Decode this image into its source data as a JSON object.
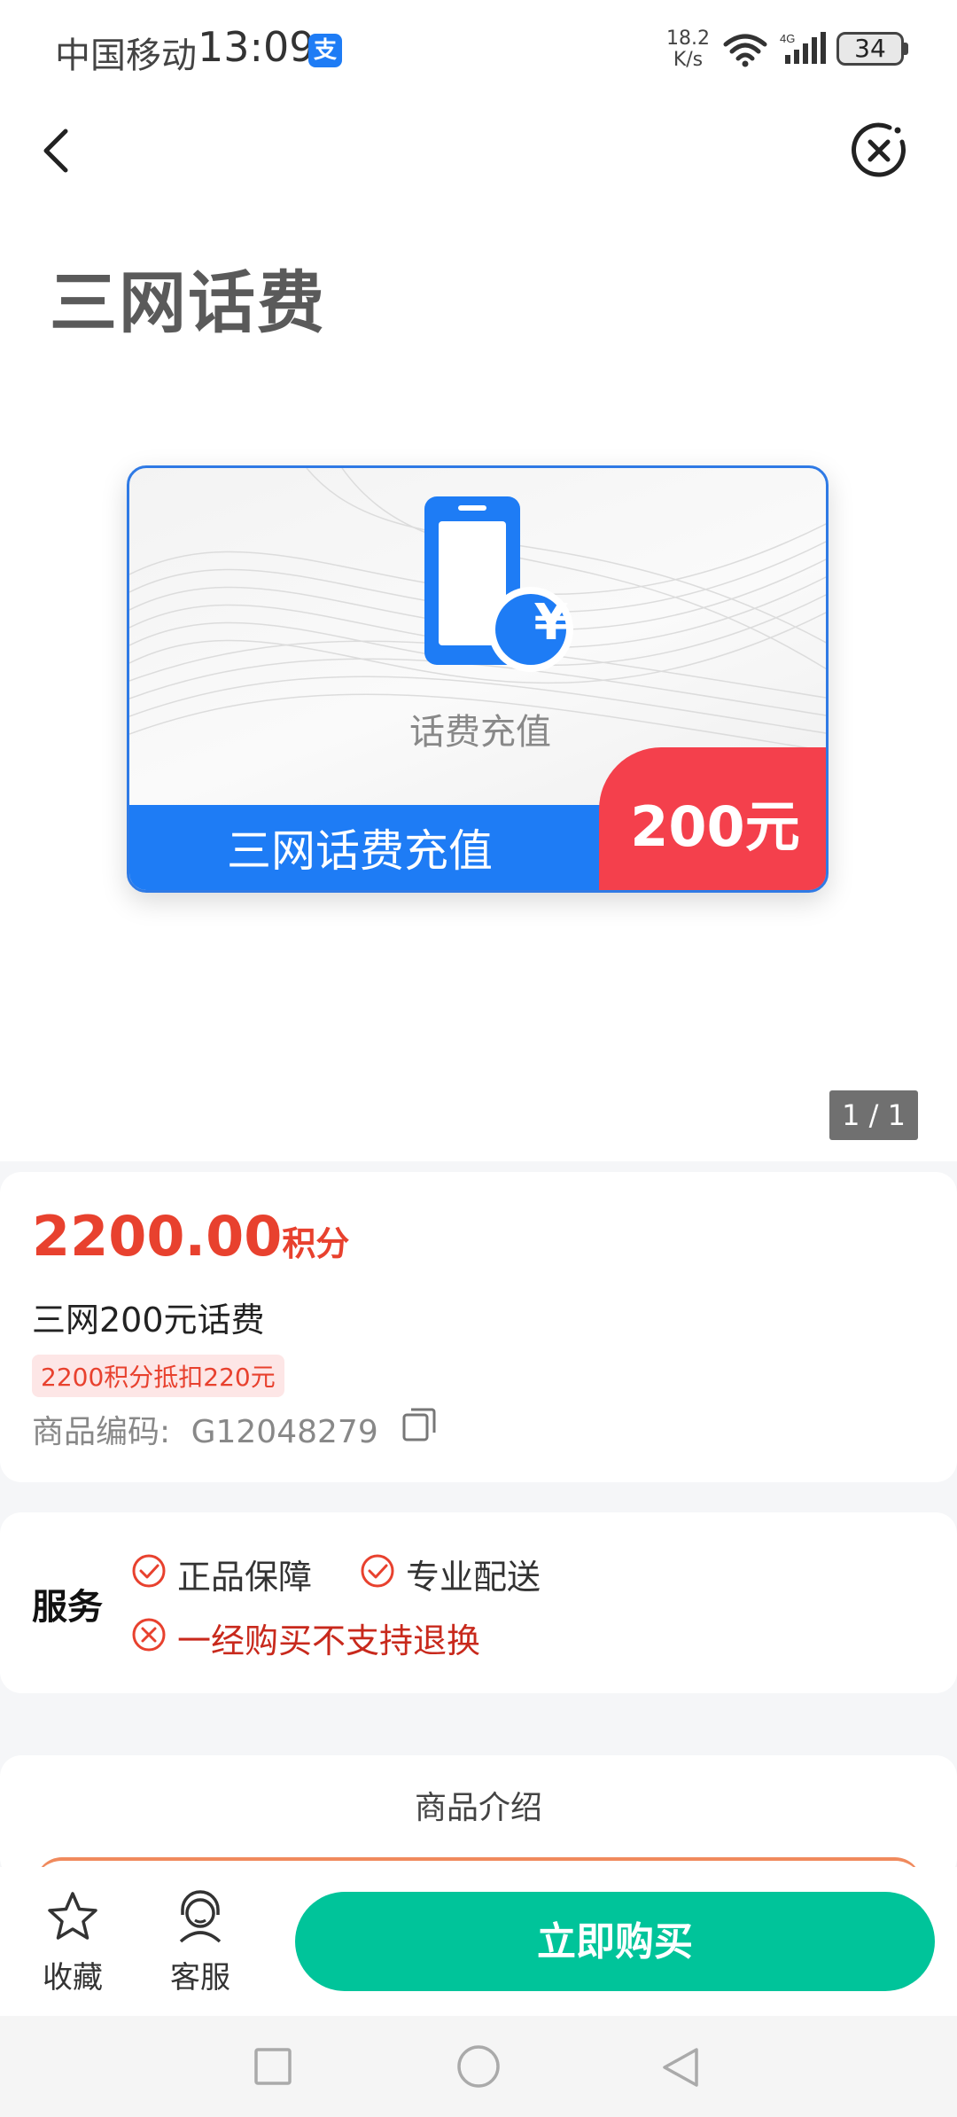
{
  "status_bar": {
    "carrier": "中国移动",
    "time": "13:09",
    "app_badge": "支",
    "net_speed_value": "18.2",
    "net_speed_unit": "K/s",
    "battery": "34"
  },
  "header": {
    "title": "三网话费"
  },
  "card": {
    "caption": "话费充值",
    "band_text": "三网话费充值",
    "price_label": "200元",
    "currency_symbol": "¥"
  },
  "pager": "1 / 1",
  "product": {
    "price": "2200.00",
    "price_unit": "积分",
    "name": "三网200元话费",
    "promo": "2200积分抵扣220元",
    "sku_label": "商品编码:",
    "sku_value": "G12048279"
  },
  "service": {
    "label": "服务",
    "items": [
      "正品保障",
      "专业配送"
    ],
    "warning": "一经购买不支持退换"
  },
  "intro": {
    "title": "商品介绍"
  },
  "bottom_bar": {
    "favorite": "收藏",
    "support": "客服",
    "buy": "立即购买"
  },
  "colors": {
    "brand_green": "#00c49a",
    "price_red": "#e8412e",
    "card_blue": "#1e7cf5",
    "card_red": "#f4404c"
  }
}
